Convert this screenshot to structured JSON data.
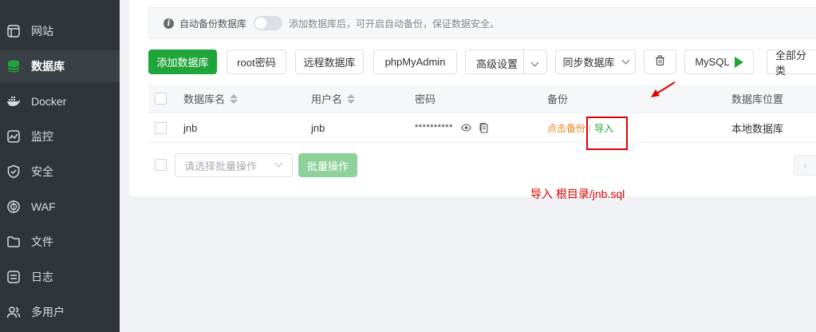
{
  "sidebar": {
    "items": [
      {
        "label": "网站",
        "icon": "website-icon",
        "active": false
      },
      {
        "label": "数据库",
        "icon": "database-icon",
        "active": true
      },
      {
        "label": "Docker",
        "icon": "docker-icon",
        "active": false
      },
      {
        "label": "监控",
        "icon": "monitor-icon",
        "active": false
      },
      {
        "label": "安全",
        "icon": "shield-icon",
        "active": false
      },
      {
        "label": "WAF",
        "icon": "waf-icon",
        "active": false
      },
      {
        "label": "文件",
        "icon": "folder-icon",
        "active": false
      },
      {
        "label": "日志",
        "icon": "log-icon",
        "active": false
      },
      {
        "label": "多用户",
        "icon": "users-icon",
        "active": false
      }
    ]
  },
  "tip": {
    "label": "自动备份数据库",
    "text": "添加数据库后，可开启自动备份，保证数据安全。",
    "toggle_on": false
  },
  "toolbar": {
    "add_db": "添加数据库",
    "root_pwd": "root密码",
    "remote_db": "远程数据库",
    "phpmyadmin": "phpMyAdmin",
    "advanced": "高级设置",
    "sync_db": "同步数据库",
    "mysql": "MySQL",
    "all_categories": "全部分类"
  },
  "table": {
    "headers": {
      "name": "数据库名",
      "user": "用户名",
      "password": "密码",
      "backup": "备份",
      "location": "数据库位置"
    },
    "rows": [
      {
        "name": "jnb",
        "user": "jnb",
        "password": "**********",
        "backup_action": "点击备份",
        "backup_sep": "|",
        "import_action": "导入",
        "location": "本地数据库"
      }
    ]
  },
  "batch": {
    "placeholder": "请选择批量操作",
    "button": "批量操作"
  },
  "pager": {
    "prev": "‹"
  },
  "annotation": {
    "text": "导入 根目录/jnb.sql"
  },
  "colors": {
    "sidebar_bg": "#2f3539",
    "accent": "#20a53a",
    "orange": "#e6841e",
    "annotation": "#e00000"
  }
}
